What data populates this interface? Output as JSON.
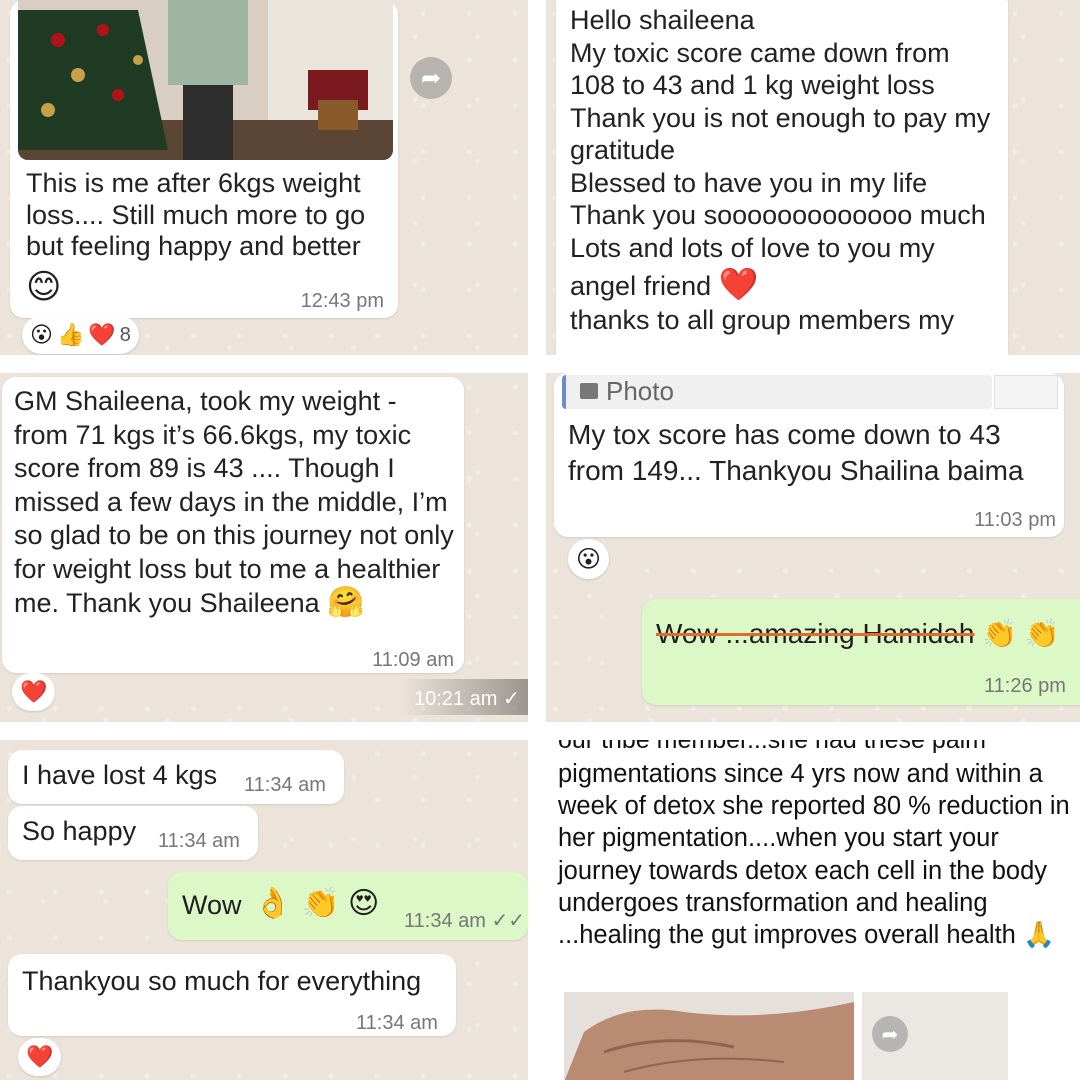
{
  "panels": {
    "top_left": {
      "caption": "This is me after 6kgs weight loss.... Still much more to go but feeling happy and better",
      "caption_emoji": "😊",
      "time": "12:43 pm",
      "reactions": [
        "😮",
        "👍",
        "❤️"
      ],
      "reaction_count": "8"
    },
    "top_right": {
      "lines": [
        "Hello shaileena",
        "My toxic score came down from",
        "108 to 43 and 1 kg weight loss",
        "Thank you is not enough to pay my",
        "gratitude",
        "Blessed to have you in my life",
        "Thank you sooooooooooooo much",
        "Lots and lots of love to you my",
        "angel friend",
        "thanks to all group members my"
      ],
      "heart_emoji": "❤️"
    },
    "mid_left": {
      "message": "GM Shaileena, took my weight - from 71 kgs it’s 66.6kgs, my toxic score from 89 is 43 .... Though I missed a few days in the middle, I’m so glad to be on this journey not only for weight loss but to me a healthier me. Thank you Shaileena",
      "hug_emoji": "🤗",
      "time": "11:09 am",
      "reaction": "❤️",
      "sent_time": "10:21 am ✓"
    },
    "mid_right": {
      "reply_label": "Photo",
      "message": "My tox score has come down to 43 from 149... Thankyou Shailina baima",
      "time": "11:03 pm",
      "reaction": "😮",
      "reply_message": "Wow ...amazing Hamidah",
      "reply_emoji": "👏 👏",
      "reply_time": "11:26 pm"
    },
    "bottom_left": {
      "messages": [
        {
          "text": "I have lost 4 kgs",
          "time": "11:34 am"
        },
        {
          "text": "So happy",
          "time": "11:34 am"
        }
      ],
      "out_text": "Wow",
      "out_emojis": [
        "👌",
        "👏",
        "😍"
      ],
      "out_time": "11:34 am ✓✓",
      "last_message": "Thankyou so much for everything",
      "last_time": "11:34 am",
      "reaction": "❤️"
    },
    "bottom_right": {
      "cut_line": "our tribe member...she had these palm",
      "text": "pigmentations since 4 yrs now and within a week of detox she reported 80 % reduction in her pigmentation....when you start your journey towards detox each cell in the body undergoes transformation and healing ...healing the gut improves overall health",
      "pray_emoji": "🙏"
    }
  },
  "icons": [
    "forward-arrow-icon",
    "smiley-icon",
    "heart-icon",
    "double-check-icon"
  ]
}
